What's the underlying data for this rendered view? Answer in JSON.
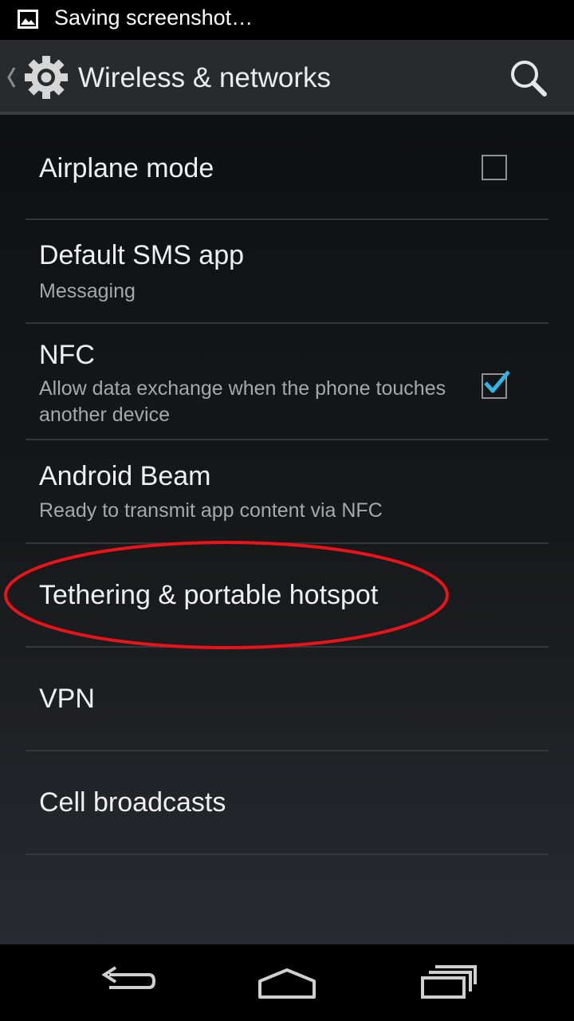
{
  "status_bar": {
    "notification_text": "Saving screenshot…",
    "notification_icon": "image-icon"
  },
  "action_bar": {
    "title": "Wireless & networks",
    "app_icon": "gear-icon",
    "action_icon": "search-icon"
  },
  "settings": {
    "items": [
      {
        "title": "Airplane mode",
        "summary": "",
        "checkbox": "unchecked"
      },
      {
        "title": "Default SMS app",
        "summary": "Messaging"
      },
      {
        "title": "NFC",
        "summary": "Allow data exchange when the phone touches another device",
        "checkbox": "checked"
      },
      {
        "title": "Android Beam",
        "summary": "Ready to transmit app content via NFC"
      },
      {
        "title": "Tethering & portable hotspot",
        "summary": "",
        "highlighted": true
      },
      {
        "title": "VPN",
        "summary": ""
      },
      {
        "title": "Cell broadcasts",
        "summary": ""
      }
    ]
  },
  "nav_bar": {
    "buttons": [
      "back-icon",
      "home-icon",
      "recent-apps-icon"
    ]
  },
  "colors": {
    "accent": "#33b5e5",
    "highlight_annotation": "#e8141a"
  }
}
